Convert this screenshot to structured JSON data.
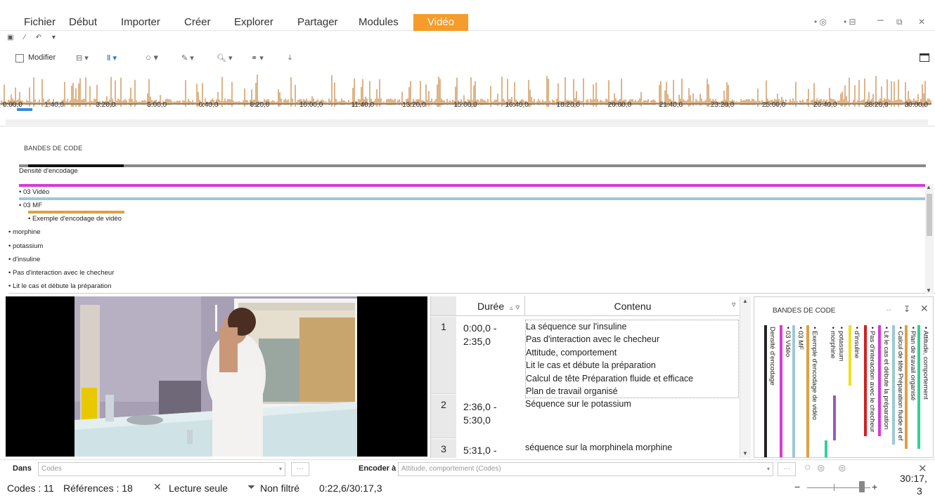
{
  "ribbon": {
    "tabs": [
      "Fichier",
      "Début",
      "Importer",
      "Créer",
      "Explorer",
      "Partager",
      "Modules",
      "Vidéo"
    ],
    "active_tab": "Vidéo",
    "accent": "#f59c2a"
  },
  "toolbar": {
    "modifier_label": "Modifier"
  },
  "timeline": {
    "ticks": [
      "0:00,0",
      "1:40,0",
      "3:20,0",
      "5:00,0",
      "6:40,0",
      "8:20,0",
      "10:00,0",
      "11:40,0",
      "13:20,0",
      "15:00,0",
      "16:40,0",
      "18:20,0",
      "20:00,0",
      "21:40,0",
      "23:20,0",
      "25:00,0",
      "26:40,0",
      "28:20,0",
      "30:00,0"
    ],
    "waveform_color": "#c8823a"
  },
  "stripes": {
    "title": "BANDES DE CODE",
    "rows": [
      {
        "label": "Densité d'encodage",
        "color": "#7a7a7a"
      },
      {
        "label": "• 03 Vidéo",
        "color": "#d63ad6"
      },
      {
        "label": "• 03 MF",
        "color": "#9ec8d6"
      },
      {
        "label": "• Exemple d'encodage de vidéo",
        "color": "#e0a040"
      },
      {
        "label": "• morphine",
        "color": ""
      },
      {
        "label": "• potassium",
        "color": ""
      },
      {
        "label": "• d'insuline",
        "color": ""
      },
      {
        "label": "• Pas d'interaction avec le checheur",
        "color": ""
      },
      {
        "label": "• Lit le cas et débute la préparation",
        "color": ""
      }
    ]
  },
  "table": {
    "col_duration": "Durée",
    "col_content": "Contenu",
    "rows": [
      {
        "num": "1",
        "duration": "0:00,0 -\n2:35,0",
        "content": [
          "La séquence sur l'insuline",
          "Pas d'interaction avec le checheur",
          "Attitude, comportement",
          "Lit le cas et débute la préparation",
          "Calcul de tête Préparation fluide et efficace",
          "Plan de travail organisé"
        ]
      },
      {
        "num": "2",
        "duration": "2:36,0 -\n5:30,0",
        "content": [
          "Séquence sur le potassium"
        ]
      },
      {
        "num": "3",
        "duration": "5:31,0 -",
        "content": [
          "séquence sur la morphinela morphine"
        ]
      }
    ]
  },
  "side_panel": {
    "title": "BANDES DE CODE",
    "labels": [
      {
        "text": "Densité d'encodage",
        "color": "#222222"
      },
      {
        "text": "• 03 Vidéo",
        "color": "#d63ad6"
      },
      {
        "text": "• 03 MF",
        "color": "#9ec8d6"
      },
      {
        "text": "• Exemple d'encodage de vidéo",
        "color": "#e0a040"
      },
      {
        "text": "• morphine",
        "color": "#2ed392"
      },
      {
        "text": "• potassium",
        "color": "#9b59b6"
      },
      {
        "text": "• d'insuline",
        "color": "#f0e020"
      },
      {
        "text": "• Pas d'interaction avec le checheur",
        "color": "#d02020"
      },
      {
        "text": "• Lit le cas et débute la préparation",
        "color": "#d63ad6"
      },
      {
        "text": "• Calcul de tête Préparation fluide et ef",
        "color": "#9ec8d6"
      },
      {
        "text": "• Plan de travail organisé",
        "color": "#e0a040"
      },
      {
        "text": "• Attitude, comportement",
        "color": "#2ed392"
      }
    ]
  },
  "bottom": {
    "dans_label": "Dans",
    "dans_value": "Codes",
    "encoder_label": "Encoder à",
    "encoder_value": "Attitude, comportement (Codes)",
    "ellipsis": "···"
  },
  "status": {
    "codes": "Codes : 11",
    "references": "Références : 18",
    "readonly": "Lecture seule",
    "filter": "Non filtré",
    "position": "0:22,6/30:17,3",
    "time_right": "30:17,",
    "time_right2": "3",
    "zoom_minus": "−",
    "zoom_plus": "+"
  }
}
